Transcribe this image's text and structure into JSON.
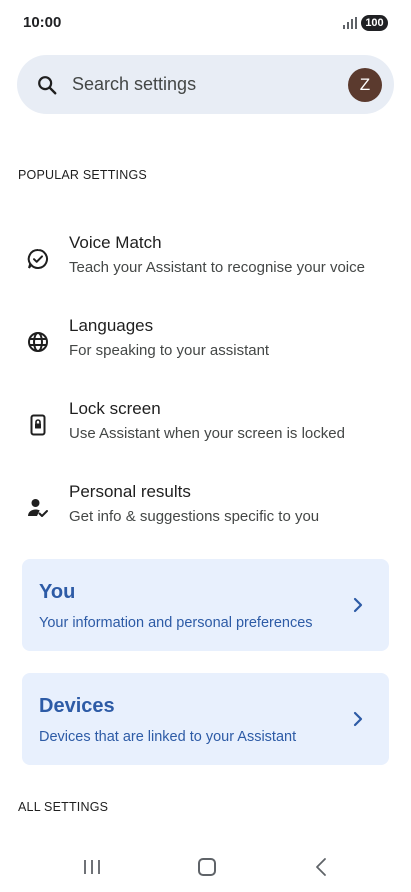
{
  "status_bar": {
    "time": "10:00",
    "battery": "100"
  },
  "search": {
    "placeholder": "Search settings",
    "avatar_letter": "Z"
  },
  "popular_settings": {
    "header": "POPULAR SETTINGS",
    "items": [
      {
        "icon": "voice-match-icon",
        "title": "Voice Match",
        "subtitle": "Teach your Assistant to recognise your voice"
      },
      {
        "icon": "globe-icon",
        "title": "Languages",
        "subtitle": "For speaking to your assistant"
      },
      {
        "icon": "lock-screen-icon",
        "title": "Lock screen",
        "subtitle": "Use Assistant when your screen is locked"
      },
      {
        "icon": "personal-results-icon",
        "title": "Personal results",
        "subtitle": "Get info & suggestions specific to you"
      }
    ]
  },
  "cards": [
    {
      "title": "You",
      "subtitle": "Your information and personal preferences"
    },
    {
      "title": "Devices",
      "subtitle": "Devices that are linked to your Assistant"
    }
  ],
  "all_settings": {
    "header": "ALL SETTINGS"
  },
  "colors": {
    "search_bg": "#e8edf5",
    "card_bg": "#e8f0fd",
    "card_text": "#2d5ba6",
    "avatar_bg": "#5b3a2e"
  }
}
